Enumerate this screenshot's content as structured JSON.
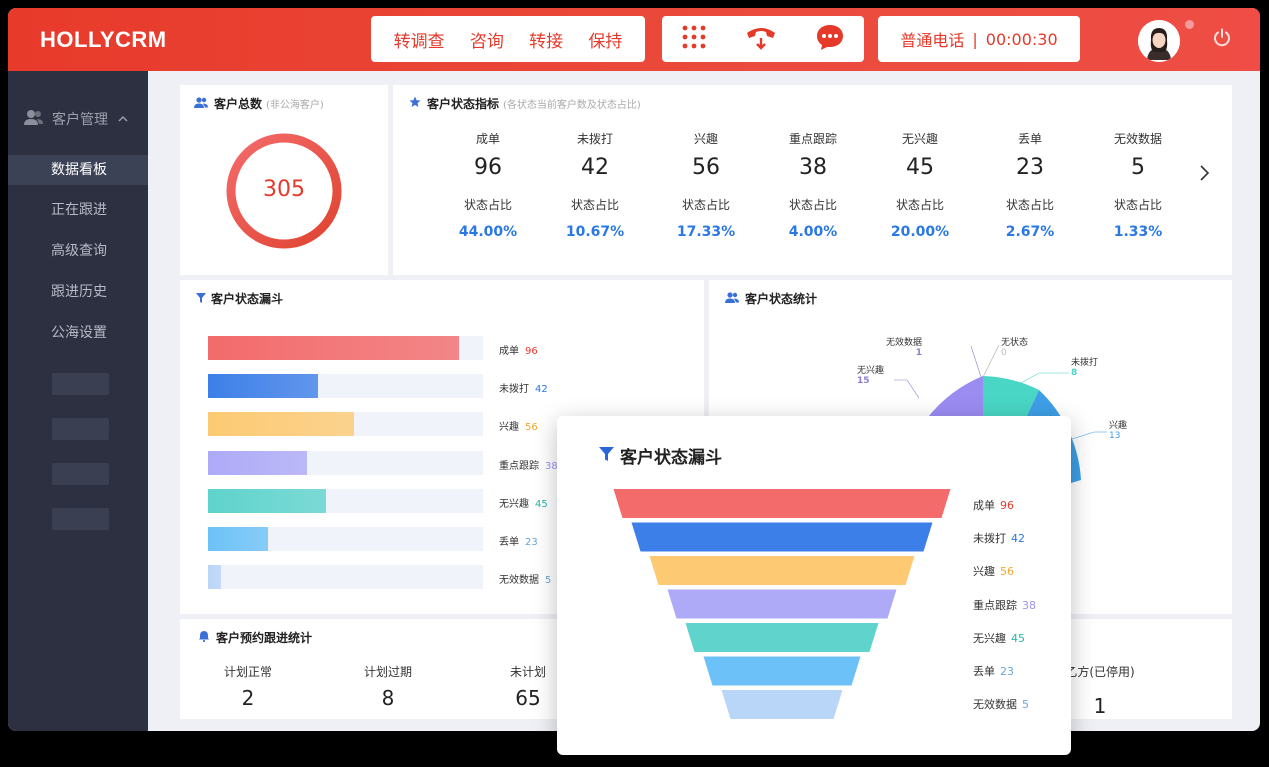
{
  "header": {
    "brand": "HOLLYCRM",
    "actions": [
      "转调查",
      "咨询",
      "转接",
      "保持"
    ],
    "icons": [
      "dialpad-icon",
      "hangup-icon",
      "chat-icon"
    ],
    "call_type": "普通电话",
    "separator": "|",
    "timer": "00:00:30",
    "colors": {
      "accent": "#e83a2b"
    }
  },
  "sidebar": {
    "section": "客户管理",
    "items": [
      "数据看板",
      "正在跟进",
      "高级查询",
      "跟进历史",
      "公海设置"
    ],
    "active": "数据看板"
  },
  "total": {
    "title": "客户总数",
    "subtitle": "(非公海客户)",
    "value": "305"
  },
  "indicators": {
    "title": "客户状态指标",
    "subtitle": "(各状态当前客户数及状态占比)",
    "ratio_label": "状态占比",
    "items": [
      {
        "label": "成单",
        "value": "96",
        "pct": "44.00%"
      },
      {
        "label": "未拨打",
        "value": "42",
        "pct": "10.67%"
      },
      {
        "label": "兴趣",
        "value": "56",
        "pct": "17.33%"
      },
      {
        "label": "重点跟踪",
        "value": "38",
        "pct": "4.00%"
      },
      {
        "label": "无兴趣",
        "value": "45",
        "pct": "20.00%"
      },
      {
        "label": "丢单",
        "value": "23",
        "pct": "2.67%"
      },
      {
        "label": "无效数据",
        "value": "5",
        "pct": "1.33%"
      }
    ]
  },
  "funnel_card": {
    "title": "客户状态漏斗",
    "rows": [
      {
        "label": "成单",
        "value": "96",
        "color": "#f36b6b",
        "value_color": "#e5392a"
      },
      {
        "label": "未拨打",
        "value": "42",
        "color": "#3d7fe8",
        "value_color": "#2a78e4"
      },
      {
        "label": "兴趣",
        "value": "56",
        "color": "#fdca73",
        "value_color": "#f0a830"
      },
      {
        "label": "重点跟踪",
        "value": "38",
        "color": "#aeaaf8",
        "value_color": "#9b93f0"
      },
      {
        "label": "无兴趣",
        "value": "45",
        "color": "#5fd3cc",
        "value_color": "#25b8a8"
      },
      {
        "label": "丢单",
        "value": "23",
        "color": "#6cc2f8",
        "value_color": "#6aa6d8"
      },
      {
        "label": "无效数据",
        "value": "5",
        "color": "#b9d5f7",
        "value_color": "#6aa6d8"
      }
    ]
  },
  "pie_card": {
    "title": "客户状态统计",
    "labels": [
      {
        "label": "无效数据",
        "value": "1"
      },
      {
        "label": "无状态",
        "value": "0"
      },
      {
        "label": "未拨打",
        "value": "8"
      },
      {
        "label": "无兴趣",
        "value": "15"
      },
      {
        "label": "兴趣",
        "value": "13"
      }
    ]
  },
  "plan_card": {
    "title": "客户预约跟进统计",
    "items": [
      {
        "label": "计划正常",
        "value": "2"
      },
      {
        "label": "计划过期",
        "value": "8"
      },
      {
        "label": "未计划",
        "value": "65"
      }
    ],
    "right_label": "乙方(已停用)",
    "right_value": "1"
  },
  "popup": {
    "title": "客户状态漏斗",
    "rows": [
      {
        "label": "成单",
        "value": "96"
      },
      {
        "label": "未拨打",
        "value": "42"
      },
      {
        "label": "兴趣",
        "value": "56"
      },
      {
        "label": "重点跟踪",
        "value": "38"
      },
      {
        "label": "无兴趣",
        "value": "45"
      },
      {
        "label": "丢单",
        "value": "23"
      },
      {
        "label": "无效数据",
        "value": "5"
      }
    ]
  }
}
